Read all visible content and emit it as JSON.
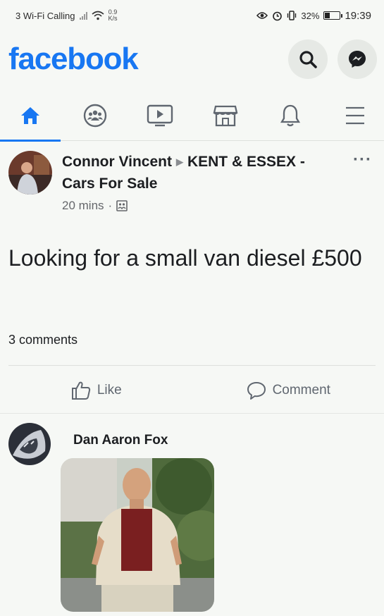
{
  "status_bar": {
    "carrier": "3 Wi-Fi Calling",
    "net_speed_value": "0.9",
    "net_speed_unit": "K/s",
    "battery_percent": "32%",
    "battery_level": 0.32,
    "time": "19:39"
  },
  "header": {
    "logo": "facebook",
    "brand_color": "#1877f2"
  },
  "nav": {
    "items": [
      {
        "icon": "home-icon",
        "active": true
      },
      {
        "icon": "groups-icon",
        "active": false
      },
      {
        "icon": "watch-icon",
        "active": false
      },
      {
        "icon": "marketplace-icon",
        "active": false
      },
      {
        "icon": "notifications-icon",
        "active": false
      },
      {
        "icon": "menu-icon",
        "active": false
      }
    ]
  },
  "post": {
    "author": "Connor Vincent",
    "group": "KENT & ESSEX - Cars For Sale",
    "time": "20 mins",
    "separator": "·",
    "text": "Looking for a small van diesel £500",
    "comments_count": "3 comments",
    "like_label": "Like",
    "comment_label": "Comment"
  },
  "comment": {
    "author": "Dan Aaron Fox"
  }
}
